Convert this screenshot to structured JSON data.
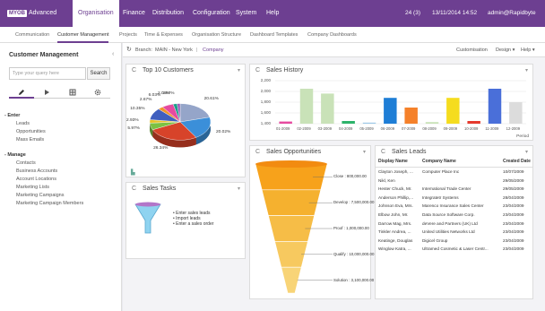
{
  "topnav": {
    "logo_text": "MYOB",
    "logo_sub": "Advanced",
    "items": [
      "Organisation",
      "Finance",
      "Distribution",
      "Configuration",
      "System",
      "Help"
    ],
    "active": "Organisation",
    "notifications": "24 (3)",
    "datetime": "13/11/2014 14:52",
    "user": "admin@Rapidbyte AU"
  },
  "subnav": {
    "items": [
      "Communication",
      "Customer Management",
      "Projects",
      "Time & Expenses",
      "Organisation Structure",
      "Dashboard Templates",
      "Company Dashboards"
    ],
    "active": "Customer Management"
  },
  "sidebar": {
    "title": "Customer Management",
    "collapse_glyph": "‹",
    "search_placeholder": "Type your query here",
    "search_button": "Search",
    "tabs": [
      "pencil-icon",
      "play-icon",
      "grid-icon",
      "gear-icon"
    ],
    "sections": [
      {
        "title": "Enter",
        "items": [
          "Leads",
          "Opportunities",
          "Mass Emails"
        ]
      },
      {
        "title": "Manage",
        "items": [
          "Contacts",
          "Business Accounts",
          "Account Locations",
          "Marketing Lists",
          "Marketing Campaigns",
          "Marketing Campaign Members"
        ]
      }
    ]
  },
  "breadcrumb": {
    "refresh_glyph": "↻",
    "prefix": "Branch:",
    "branch": "MAIN - New York",
    "company": "Company",
    "right_items": [
      "Customisation",
      "Design ▾",
      "Help ▾"
    ]
  },
  "widgets": {
    "top_customers": {
      "title": "Top 10 Customers",
      "refresh": "C",
      "collapse": "▾"
    },
    "sales_history": {
      "title": "Sales History",
      "refresh": "C",
      "collapse": "▾",
      "period_label": "Period"
    },
    "sales_opportunities": {
      "title": "Sales Opportunities",
      "refresh": "C",
      "collapse": "▾"
    },
    "sales_tasks": {
      "title": "Sales Tasks",
      "refresh": "C",
      "collapse": "▾",
      "items": [
        "Enter sales leads",
        "Import leads",
        "Enter a sales order"
      ]
    },
    "sales_leads": {
      "title": "Sales Leads",
      "refresh": "C",
      "collapse": "▾",
      "columns": [
        "Display Name",
        "Company Name",
        "Created Date"
      ],
      "rows": [
        [
          "Clayton Joseph, ...",
          "Computer Place Inc",
          "10/07/2009"
        ],
        [
          "Nikl, Ken",
          "",
          "29/05/2009"
        ],
        [
          "Hester Chuck, Mr.",
          "International Trade Center",
          "29/05/2009"
        ],
        [
          "Anderson Phillip,...",
          "Integratetr Systems",
          "28/04/2009"
        ],
        [
          "Johnson Eva, Mrs.",
          "Marenco Insurance Sales Center",
          "23/04/2009"
        ],
        [
          "Elbow John, Mr.",
          "Data Source Software Corp.",
          "23/04/2009"
        ],
        [
          "Darrow Mag, Mrs.",
          "deVere and Partners (UK) Ltd",
          "23/04/2009"
        ],
        [
          "Tinkler Andrea, ...",
          "United Utilities Networks Ltd",
          "23/04/2009"
        ],
        [
          "Keatinge, Douglas",
          "Digicel Group",
          "23/04/2009"
        ],
        [
          "Winglow Katra, ...",
          "Ultramed Cosmetic & Laser Centr...",
          "23/04/2009"
        ]
      ]
    }
  },
  "colors": {
    "brand": "#6d3f91"
  },
  "chart_data": [
    {
      "type": "pie",
      "title": "Top 10 Customers",
      "values": [
        20.61,
        20.02,
        26.34,
        5.97,
        2.93,
        10.35,
        2.67,
        6.03,
        2.09,
        1.57
      ],
      "labels": [
        "20.61%",
        "20.02%",
        "26.34%",
        "5.97%",
        "2.93%",
        "10.35%",
        "2.67%",
        "6.03%",
        "2.09%",
        "1.57%"
      ],
      "colors": [
        "#95a5c9",
        "#3b8fd9",
        "#d7432a",
        "#7cc143",
        "#e8c32b",
        "#3f5fbf",
        "#f0932b",
        "#e64aa0",
        "#1a9e8a",
        "#9b59b6"
      ]
    },
    {
      "type": "bar",
      "title": "Sales History",
      "xlabel": "Period",
      "categories": [
        "01-2009",
        "02-2009",
        "03-2009",
        "04-2009",
        "05-2009",
        "06-2009",
        "07-2009",
        "08-2009",
        "09-2009",
        "10-2009",
        "11-2009",
        "12-2009"
      ],
      "values": [
        1440,
        2050,
        1960,
        1450,
        1420,
        1880,
        1700,
        1430,
        1880,
        1450,
        2050,
        1800
      ],
      "colors": [
        "#e64aa0",
        "#c9e2b8",
        "#c9e2b8",
        "#2eb36b",
        "#9ec9e8",
        "#1e7ed6",
        "#f5812a",
        "#c9e2b8",
        "#f5dc1e",
        "#e63a2e",
        "#4a6fd9",
        "#dcdcdc"
      ],
      "yticks": [
        1400,
        1600,
        1800,
        2000,
        2200
      ],
      "ylim": [
        1400,
        2200
      ]
    },
    {
      "type": "funnel",
      "title": "Sales Opportunities",
      "stages": [
        {
          "name": "Close",
          "value": 800000
        },
        {
          "name": "Develop",
          "value": 7500000
        },
        {
          "name": "Proof",
          "value": 1000000
        },
        {
          "name": "Qualify",
          "value": 10000000
        },
        {
          "name": "Solution",
          "value": 3100000
        }
      ],
      "labels": [
        "Close : 800,000.00",
        "Develop : 7,500,000.00",
        "Proof : 1,000,000.00",
        "Qualify : 10,000,000.00",
        "Solution : 3,100,000.00"
      ]
    }
  ]
}
